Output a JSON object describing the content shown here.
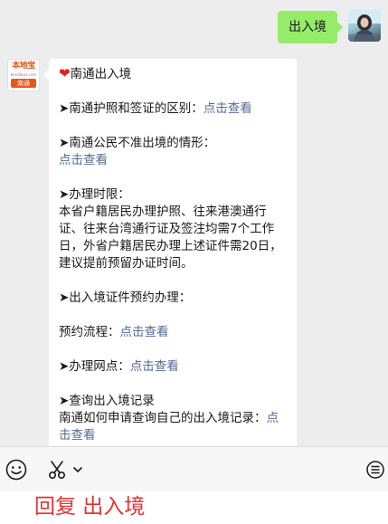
{
  "outgoing": {
    "text": "出入境"
  },
  "incoming": {
    "title": "南通出入境",
    "passport_visa_text": "➤南通护照和签证的区别：",
    "passport_visa_link": "点击查看",
    "no_exit_text": "➤南通公民不准出境的情形：",
    "no_exit_link": "点击查看",
    "time_limit_title": "➤办理时限：",
    "time_limit_body": "本省户籍居民办理护照、往来港澳通行证、往来台湾通行证及签注均需7个工作日，外省户籍居民办理上述证件需20日，建议提前预留办证时间。",
    "appointment_title": "➤出入境证件预约办理：",
    "appointment_text": "预约流程：",
    "appointment_link": "点击查看",
    "office_text": "➤办理网点：",
    "office_link": "点击查看",
    "record_title": "➤查询出入境记录",
    "record_text": "南通如何申请查询自己的出入境记录：",
    "record_link": "点击查看"
  },
  "brand_avatar": {
    "top": "本地宝",
    "mid": "bendibao.com",
    "bottom": "南通"
  },
  "toolbar": {
    "emoji_icon": "emoji-icon",
    "scissors_icon": "scissors-icon",
    "dropdown_icon": "chevron-down-icon",
    "menu_icon": "menu-list-icon"
  },
  "reply_overlay": {
    "text": "回复 出入境"
  },
  "colors": {
    "outgoing_bubble": "#95ec69",
    "link": "#576b95",
    "reply": "#e53333",
    "background": "#ededed"
  }
}
